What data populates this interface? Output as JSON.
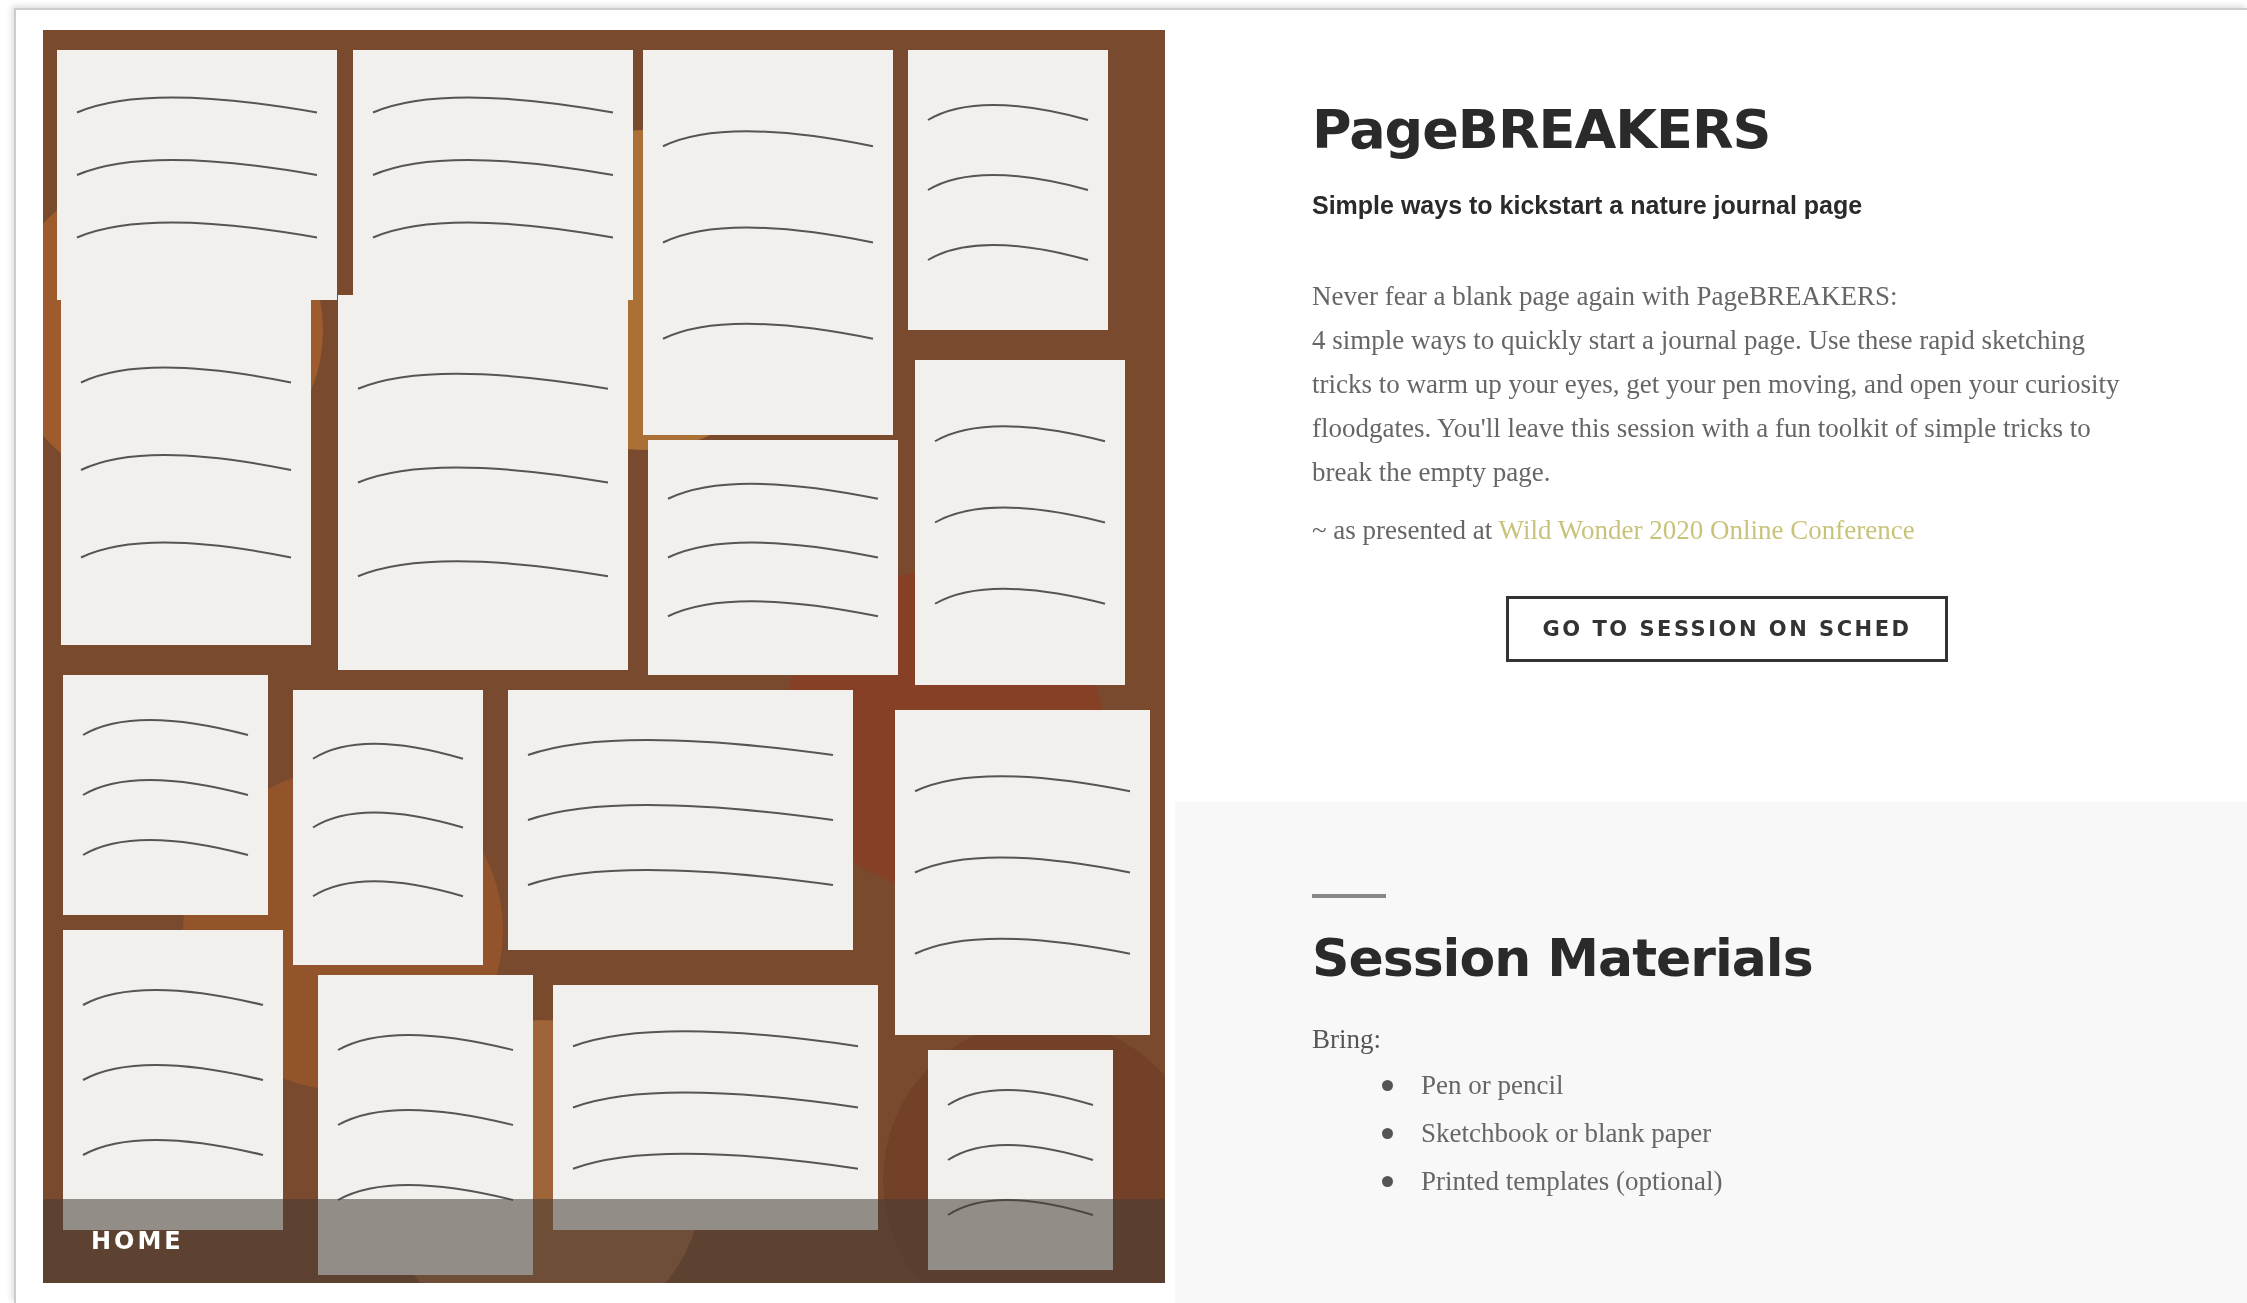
{
  "nav": {
    "home_link": "HOME"
  },
  "intro": {
    "title": "PageBREAKERS",
    "subtitle": "Simple ways to kickstart a nature journal page",
    "description": [
      "Never fear a blank page again with PageBREAKERS:",
      "4 simple ways to quickly start a journal page. Use these rapid sketching tricks to warm up your eyes, get your pen moving, and open your curiosity floodgates. You'll leave this session with a fun toolkit of simple tricks to break the empty page."
    ],
    "credit": {
      "prefix": "~ as presented at",
      "link": "Wild Wonder 2020 Online Conference"
    },
    "button": "GO TO SESSION ON SCHED"
  },
  "materials": {
    "title": "Session Materials",
    "bring_label": "Bring:",
    "items": [
      "Pen or pencil",
      "Sketchbook or blank paper",
      "Printed templates (optional)"
    ]
  }
}
